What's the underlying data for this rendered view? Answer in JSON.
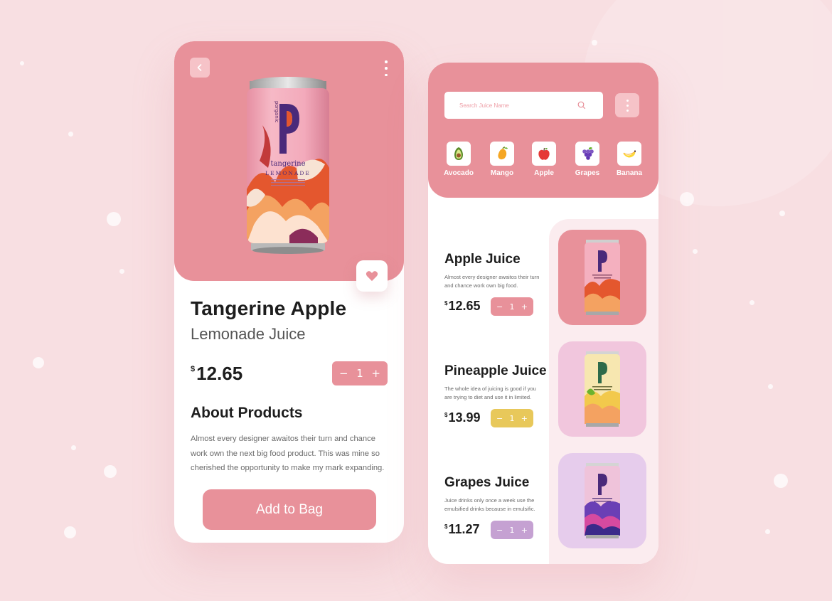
{
  "theme": {
    "accent": "#e8919a",
    "accent_light": "#f6c3c8",
    "pineapple_accent": "#e8c85a",
    "grapes_accent": "#c5a1d2",
    "background": "#f8dfe2"
  },
  "detail": {
    "back_icon": "chevron-left-icon",
    "menu_icon": "kebab-menu-icon",
    "favorite_icon": "heart-icon",
    "can": {
      "brand": "porganic",
      "flavor": "tangerine",
      "type": "LEMONADE"
    },
    "title": "Tangerine Apple",
    "subtitle": "Lemonade Juice",
    "price": {
      "currency": "$",
      "amount": "12.65"
    },
    "quantity": {
      "minus": "−",
      "value": "1",
      "plus": "+"
    },
    "about_title": "About Products",
    "about_text": "Almost every designer awaitos their turn and chance work own the next big food product. This was mine so cherished the opportunity to make my mark expanding.",
    "add_button": "Add to Bag"
  },
  "list": {
    "search_placeholder": "Search Juice Name",
    "categories": [
      {
        "label": "Avocado",
        "icon": "avocado-icon"
      },
      {
        "label": "Mango",
        "icon": "mango-icon"
      },
      {
        "label": "Apple",
        "icon": "apple-icon"
      },
      {
        "label": "Grapes",
        "icon": "grapes-icon"
      },
      {
        "label": "Banana",
        "icon": "banana-icon"
      }
    ],
    "items": [
      {
        "name": "Apple Juice",
        "description": "Almost every designer awaitos their turn and chance work own big food.",
        "price": {
          "currency": "$",
          "amount": "12.65"
        },
        "quantity": {
          "minus": "−",
          "value": "1",
          "plus": "+"
        }
      },
      {
        "name": "Pineapple Juice",
        "description": "The whole idea of juicing is good if you are trying to diet and use it in limited.",
        "price": {
          "currency": "$",
          "amount": "13.99"
        },
        "quantity": {
          "minus": "−",
          "value": "1",
          "plus": "+"
        }
      },
      {
        "name": "Grapes Juice",
        "description": "Juice drinks only once a week use the emulsified drinks because in emulsific.",
        "price": {
          "currency": "$",
          "amount": "11.27"
        },
        "quantity": {
          "minus": "−",
          "value": "1",
          "plus": "+"
        }
      }
    ]
  }
}
